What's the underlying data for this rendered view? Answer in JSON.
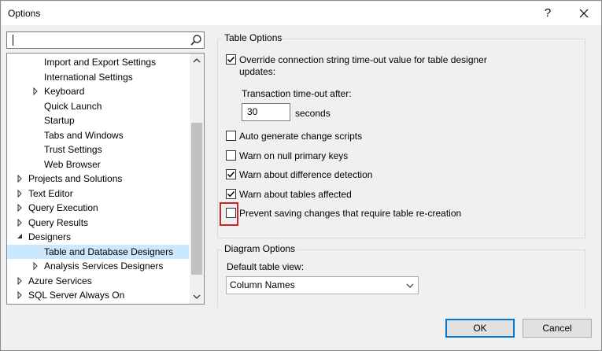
{
  "window": {
    "title": "Options",
    "help_label": "?"
  },
  "search": {
    "value": "",
    "placeholder": ""
  },
  "tree": {
    "items": [
      {
        "label": "Import and Export Settings",
        "indent": 2,
        "arrow": "none"
      },
      {
        "label": "International Settings",
        "indent": 2,
        "arrow": "none"
      },
      {
        "label": "Keyboard",
        "indent": 2,
        "arrow": "collapsed"
      },
      {
        "label": "Quick Launch",
        "indent": 2,
        "arrow": "none"
      },
      {
        "label": "Startup",
        "indent": 2,
        "arrow": "none"
      },
      {
        "label": "Tabs and Windows",
        "indent": 2,
        "arrow": "none"
      },
      {
        "label": "Trust Settings",
        "indent": 2,
        "arrow": "none"
      },
      {
        "label": "Web Browser",
        "indent": 2,
        "arrow": "none"
      },
      {
        "label": "Projects and Solutions",
        "indent": 1,
        "arrow": "collapsed"
      },
      {
        "label": "Text Editor",
        "indent": 1,
        "arrow": "collapsed"
      },
      {
        "label": "Query Execution",
        "indent": 1,
        "arrow": "collapsed"
      },
      {
        "label": "Query Results",
        "indent": 1,
        "arrow": "collapsed"
      },
      {
        "label": "Designers",
        "indent": 1,
        "arrow": "expanded"
      },
      {
        "label": "Table and Database Designers",
        "indent": 2,
        "arrow": "none",
        "selected": true
      },
      {
        "label": "Analysis Services Designers",
        "indent": 2,
        "arrow": "collapsed"
      },
      {
        "label": "Azure Services",
        "indent": 1,
        "arrow": "collapsed"
      },
      {
        "label": "SQL Server Always On",
        "indent": 1,
        "arrow": "collapsed"
      }
    ]
  },
  "table_options": {
    "title": "Table Options",
    "override_line1": "Override connection string time-out value for table designer",
    "override_line2": "updates:",
    "override_checked": true,
    "timeout_label": "Transaction time-out after:",
    "timeout_value": "30",
    "timeout_unit": "seconds",
    "checks": [
      {
        "label": "Auto generate change scripts",
        "checked": false
      },
      {
        "label": "Warn on null primary keys",
        "checked": false
      },
      {
        "label": "Warn about difference detection",
        "checked": true
      },
      {
        "label": "Warn about tables affected",
        "checked": true
      },
      {
        "label": "Prevent saving changes that require table re-creation",
        "checked": false
      }
    ]
  },
  "diagram_options": {
    "title": "Diagram Options",
    "default_view_label": "Default table view:",
    "default_view_value": "Column Names"
  },
  "buttons": {
    "ok": "OK",
    "cancel": "Cancel"
  },
  "colors": {
    "selection": "#cce8ff",
    "default_button_border": "#0078d7",
    "highlight": "#c62828"
  }
}
